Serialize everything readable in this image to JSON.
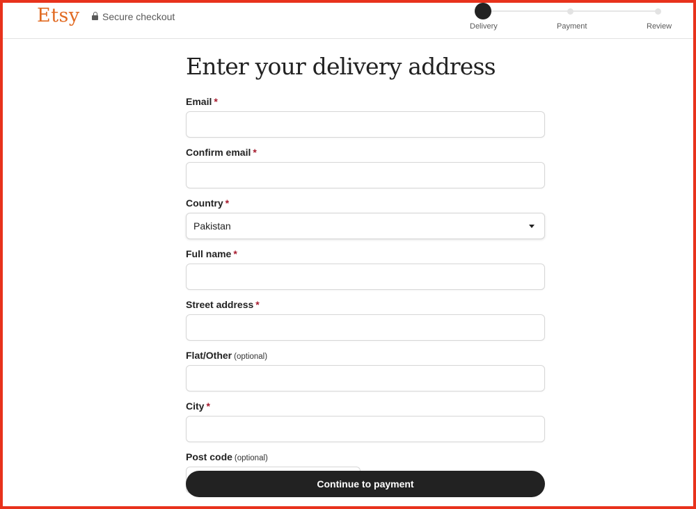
{
  "header": {
    "logo": "Etsy",
    "secure_label": "Secure checkout",
    "steps": [
      {
        "label": "Delivery",
        "state": "active"
      },
      {
        "label": "Payment",
        "state": "pending"
      },
      {
        "label": "Review",
        "state": "pending"
      }
    ]
  },
  "main": {
    "title": "Enter your delivery address",
    "fields": {
      "email": {
        "label": "Email",
        "required": "*",
        "value": ""
      },
      "confirm_email": {
        "label": "Confirm email",
        "required": "*",
        "value": ""
      },
      "country": {
        "label": "Country",
        "required": "*",
        "value": "Pakistan"
      },
      "full_name": {
        "label": "Full name",
        "required": "*",
        "value": ""
      },
      "street_address": {
        "label": "Street address",
        "required": "*",
        "value": ""
      },
      "flat_other": {
        "label": "Flat/Other",
        "optional": "(optional)",
        "value": ""
      },
      "city": {
        "label": "City",
        "required": "*",
        "value": ""
      },
      "post_code": {
        "label": "Post code",
        "optional": "(optional)",
        "value": ""
      }
    },
    "continue_label": "Continue to payment"
  },
  "colors": {
    "brand": "#e16a22",
    "required": "#a61a2e",
    "cta_bg": "#222222",
    "frame": "#e8321c"
  }
}
